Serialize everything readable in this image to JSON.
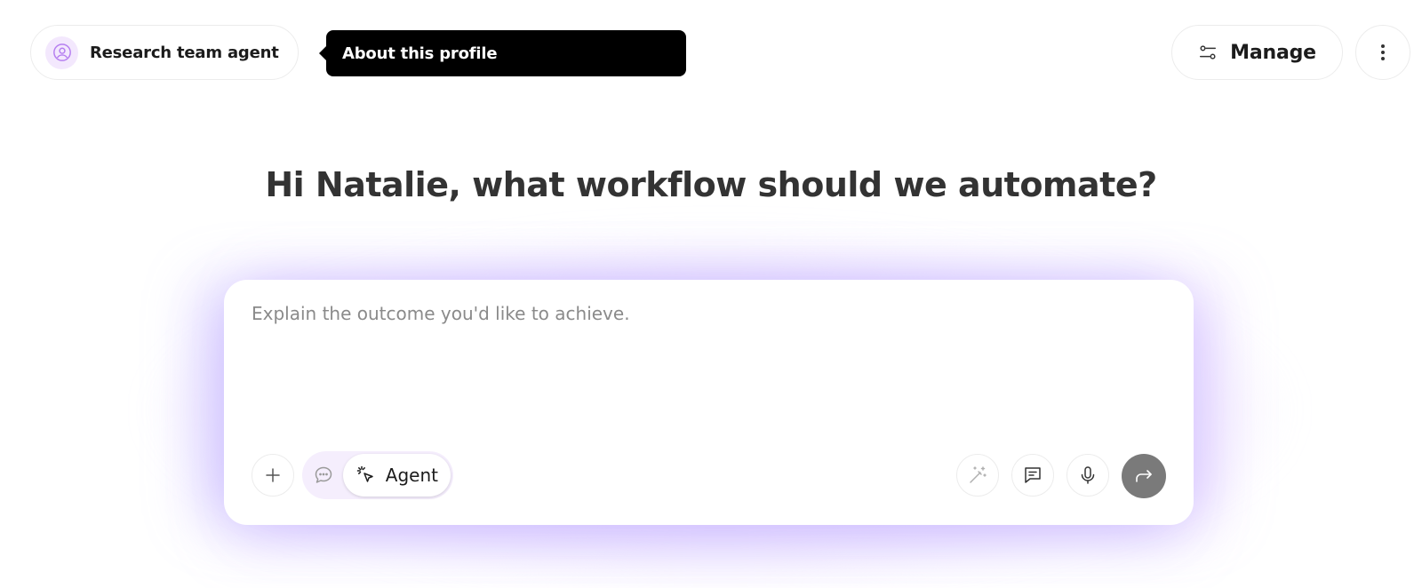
{
  "header": {
    "profile_label": "Research team agent",
    "tooltip_text": "About this profile",
    "manage_label": "Manage",
    "more_icon": "more-vertical-icon"
  },
  "main": {
    "title": "Hi Natalie, what workflow should we automate?"
  },
  "composer": {
    "placeholder": "Explain the outcome you'd like to achieve.",
    "value": "",
    "mode_agent_label": "Agent",
    "selected_mode": "Agent",
    "icons": {
      "attach": "plus-icon",
      "chat_mode": "chat-bubble-icon",
      "agent_mode": "cursor-click-icon",
      "enhance": "magic-wand-icon",
      "chat": "message-square-icon",
      "mic": "microphone-icon",
      "send": "forward-arrow-icon"
    }
  },
  "colors": {
    "accent_light": "#f3e8fd",
    "accent_icon": "#b57ef0",
    "send_button": "#7a7a7a",
    "tooltip_bg": "#000000",
    "title_text": "#333333"
  }
}
